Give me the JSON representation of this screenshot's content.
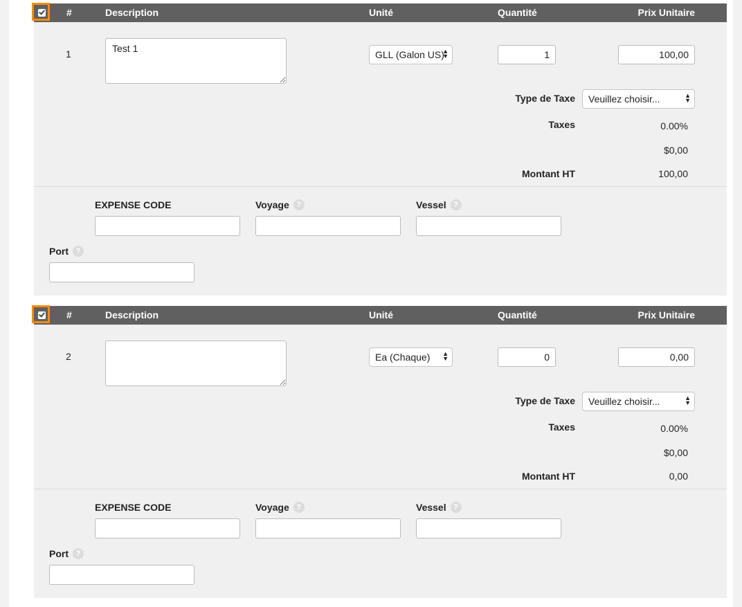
{
  "header": {
    "hash": "#",
    "description": "Description",
    "unit": "Unité",
    "quantity": "Quantité",
    "unit_price": "Prix Unitaire"
  },
  "labels": {
    "tax_type": "Type de Taxe",
    "taxes": "Taxes",
    "montant_ht": "Montant HT",
    "expense_code": "EXPENSE CODE",
    "voyage": "Voyage",
    "vessel": "Vessel",
    "port": "Port",
    "help_icon": "?"
  },
  "items": [
    {
      "checked": true,
      "number": "1",
      "description": "Test 1",
      "unit": "GLL (Galon US)",
      "quantity": "1",
      "unit_price": "100,00",
      "tax_type": "Veuillez choisir...",
      "tax_percent": "0.00%",
      "tax_amount": "$0,00",
      "montant_ht": "100,00",
      "expense_code": "",
      "voyage": "",
      "vessel": "",
      "port": ""
    },
    {
      "checked": true,
      "number": "2",
      "description": "",
      "unit": "Ea (Chaque)",
      "quantity": "0",
      "unit_price": "0,00",
      "tax_type": "Veuillez choisir...",
      "tax_percent": "0.00%",
      "tax_amount": "$0,00",
      "montant_ht": "0,00",
      "expense_code": "",
      "voyage": "",
      "vessel": "",
      "port": ""
    }
  ],
  "colors": {
    "header_bg": "#606060",
    "highlight": "#f28c13",
    "panel_bg": "#f0f0f0"
  }
}
